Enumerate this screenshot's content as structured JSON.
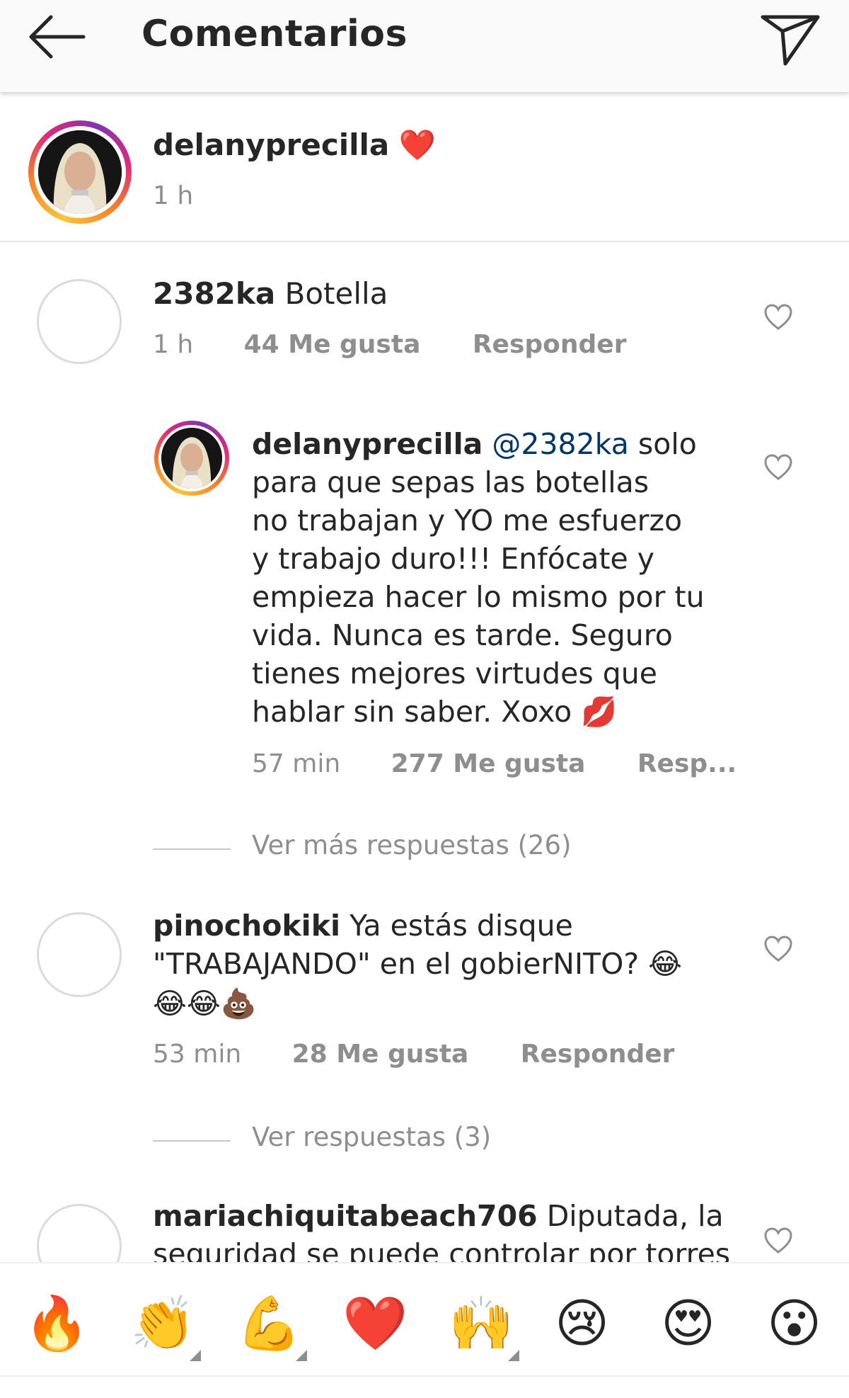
{
  "header": {
    "title": "Comentarios",
    "back_icon": "arrow-left-icon",
    "share_icon": "paper-plane-icon"
  },
  "caption": {
    "username": "delanyprecilla",
    "emoji": "❤️",
    "time": "1 h"
  },
  "comments": [
    {
      "username": "2382ka",
      "text": "Botella",
      "time": "1 h",
      "likes": "44 Me gusta",
      "reply": "Responder",
      "replies": [
        {
          "username": "delanyprecilla",
          "mention": "@2382ka",
          "text_lines": [
            "solo",
            "para que sepas las botellas",
            "no trabajan y YO me esfuerzo",
            "y trabajo duro!!! Enfócate y",
            "empieza hacer lo mismo por tu",
            "vida. Nunca es tarde. Seguro",
            "tienes mejores virtudes que",
            "hablar sin saber. Xoxo 💋"
          ],
          "time": "57 min",
          "likes": "277 Me gusta",
          "reply": "Resp..."
        }
      ],
      "more_replies": "Ver más respuestas (26)"
    },
    {
      "username": "pinochokiki",
      "text_lines": [
        "Ya estás disque",
        "\"TRABAJANDO\" en el gobierNITO? 😂",
        "😂😂💩"
      ],
      "time": "53 min",
      "likes": "28 Me gusta",
      "reply": "Responder",
      "more_replies": "Ver respuestas (3)"
    },
    {
      "username": "mariachiquitabeach706",
      "text_lines": [
        "Diputada, la",
        "seguridad se puede controlar por torres"
      ]
    }
  ],
  "emoji_bar": [
    "🔥",
    "👏",
    "💪",
    "❤️",
    "🙌",
    "😢",
    "😍",
    "😮"
  ],
  "colors": {
    "mention": "#003569",
    "secondary_text": "#8e8e8e",
    "primary_text": "#262626"
  }
}
